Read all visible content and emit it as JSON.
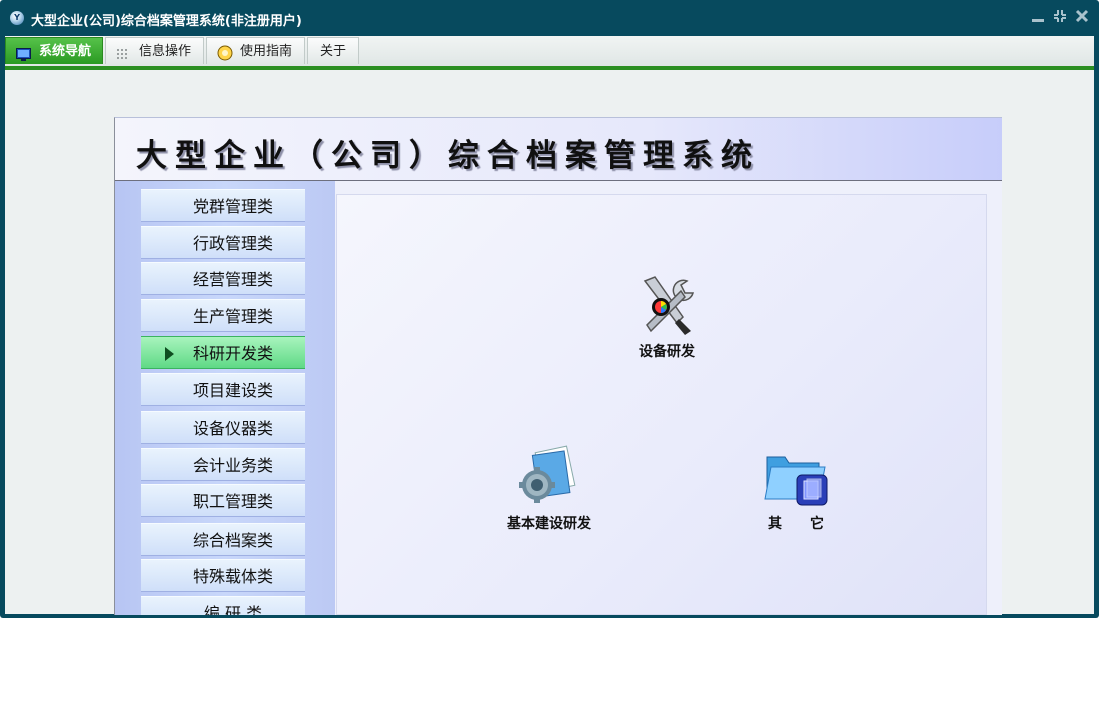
{
  "window": {
    "title": "大型企业(公司)综合档案管理系统(非注册用户)"
  },
  "menu": {
    "tabs": [
      {
        "label": "系统导航",
        "icon": "monitor-icon",
        "active": true
      },
      {
        "label": "信息操作",
        "icon": "grid-icon",
        "active": false
      },
      {
        "label": "使用指南",
        "icon": "compass-icon",
        "active": false
      },
      {
        "label": "关于",
        "icon": "",
        "active": false
      }
    ]
  },
  "header": {
    "title": "大型企业（公司）综合档案管理系统"
  },
  "sidebar": {
    "items": [
      {
        "label": "党群管理类"
      },
      {
        "label": "行政管理类"
      },
      {
        "label": "经营管理类"
      },
      {
        "label": "生产管理类"
      },
      {
        "label": "科研开发类",
        "active": true
      },
      {
        "label": "项目建设类"
      },
      {
        "label": "设备仪器类"
      },
      {
        "label": "会计业务类"
      },
      {
        "label": "职工管理类"
      },
      {
        "label": "综合档案类"
      },
      {
        "label": "特殊载体类"
      },
      {
        "label": "编 研 类"
      }
    ]
  },
  "modules": [
    {
      "label": "设备研发",
      "icon": "tools-icon"
    },
    {
      "label": "基本建设研发",
      "icon": "gear-document-icon"
    },
    {
      "label": "其　　它",
      "icon": "folder-icon"
    }
  ],
  "colors": {
    "title_bar": "#074a5e",
    "menu_accent": "#2b8f22",
    "active_item": "#5fd986"
  }
}
